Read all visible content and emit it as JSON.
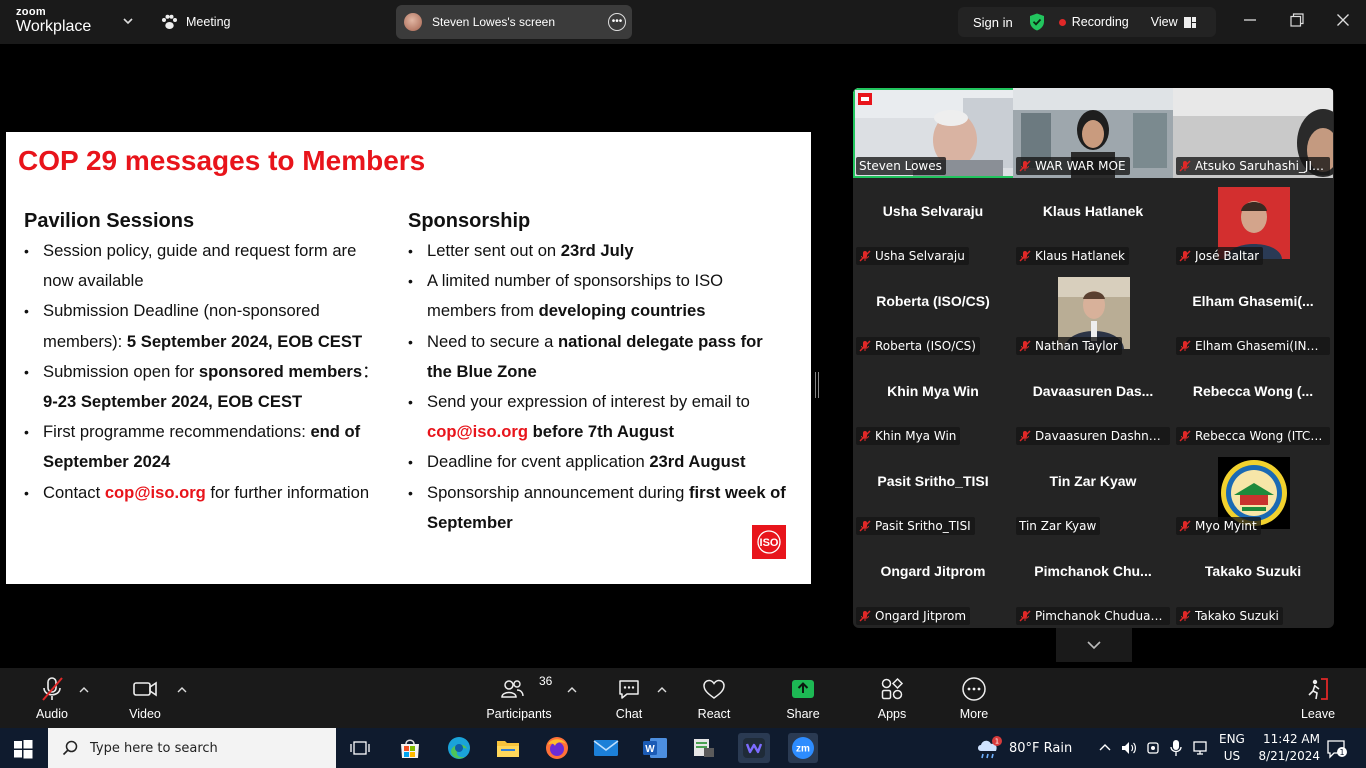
{
  "app": {
    "logo_top": "zoom",
    "logo_bottom": "Workplace",
    "meeting_label": "Meeting",
    "share_label": "Steven Lowes's screen",
    "sign_in": "Sign in",
    "recording": "Recording",
    "view": "View",
    "colors": {
      "accent_green": "#22c55e",
      "recording_red": "#e02828",
      "share_green": "#1db954"
    }
  },
  "slide": {
    "title": "COP 29 messages to Members",
    "left_heading": "Pavilion Sessions",
    "left_bullets": [
      [
        "Session policy, guide and request form are now available"
      ],
      [
        "Submission Deadline (non-sponsored members): ",
        "5 September 2024, EOB CEST"
      ],
      [
        "Submission open for ",
        "sponsored members",
        "：",
        "9-23 September 2024, EOB CEST"
      ],
      [
        "First programme recommendations: ",
        "end of September 2024"
      ],
      [
        "Contact ",
        "cop@iso.org",
        " for further information"
      ]
    ],
    "right_heading": "Sponsorship",
    "right_bullets": [
      [
        "Letter sent out on ",
        "23rd July"
      ],
      [
        "A limited number of sponsorships to ISO members from ",
        "developing countries"
      ],
      [
        "Need to secure a ",
        "national delegate pass for the Blue Zone"
      ],
      [
        "Send your expression of interest by email to ",
        "cop@iso.org",
        " before 7th August"
      ],
      [
        "Deadline for cvent application ",
        "23rd August"
      ],
      [
        "Sponsorship announcement during ",
        "first week of September"
      ]
    ],
    "iso_logo": "ISO",
    "colors": {
      "title_red": "#e8141b"
    }
  },
  "participants": [
    {
      "tag": "Steven Lowes",
      "muted": false,
      "video": true
    },
    {
      "tag": "WAR WAR MOE",
      "muted": true,
      "video": true
    },
    {
      "tag": "Atsuko Saruhashi_JISC",
      "muted": true,
      "video": true
    },
    {
      "name": "Usha Selvaraju",
      "tag": "Usha Selvaraju",
      "muted": true
    },
    {
      "name": "Klaus Hatlanek",
      "tag": "Klaus Hatlanek",
      "muted": true
    },
    {
      "tag": "José Baltar",
      "muted": true,
      "avatar": true
    },
    {
      "name": "Roberta (ISO/CS)",
      "tag": "Roberta (ISO/CS)",
      "muted": true
    },
    {
      "tag": "Nathan Taylor",
      "muted": true,
      "avatar": true
    },
    {
      "name": "Elham  Ghasemi(...",
      "tag": "Elham Ghasemi(INSO,...",
      "muted": true
    },
    {
      "name": "Khin Mya Win",
      "tag": "Khin Mya Win",
      "muted": true
    },
    {
      "name": "Davaasuren  Das...",
      "tag": "Davaasuren Dashnyam",
      "muted": true
    },
    {
      "name": "Rebecca Wong  (...",
      "tag": "Rebecca Wong (ITCH...",
      "muted": true
    },
    {
      "name": "Pasit Sritho_TISI",
      "tag": "Pasit Sritho_TISI",
      "muted": true
    },
    {
      "name": "Tin Zar Kyaw",
      "tag": "Tin Zar Kyaw",
      "muted": false
    },
    {
      "tag": "Myo Myint",
      "muted": true,
      "avatar": true
    },
    {
      "name": "Ongard Jitprom",
      "tag": "Ongard Jitprom",
      "muted": true
    },
    {
      "name": "Pimchanok  Chu...",
      "tag": "Pimchanok Chuduang...",
      "muted": true
    },
    {
      "name": "Takako Suzuki",
      "tag": "Takako Suzuki",
      "muted": true
    }
  ],
  "toolbar": {
    "audio": "Audio",
    "video": "Video",
    "participants": "Participants",
    "participants_count": "36",
    "chat": "Chat",
    "react": "React",
    "share": "Share",
    "apps": "Apps",
    "more": "More",
    "leave": "Leave"
  },
  "taskbar": {
    "search_placeholder": "Type here to search",
    "weather": "80°F  Rain",
    "lang_top": "ENG",
    "lang_bottom": "US",
    "time": "11:42 AM",
    "date": "8/21/2024",
    "edge_badge": "1",
    "notif_badge": "1"
  }
}
